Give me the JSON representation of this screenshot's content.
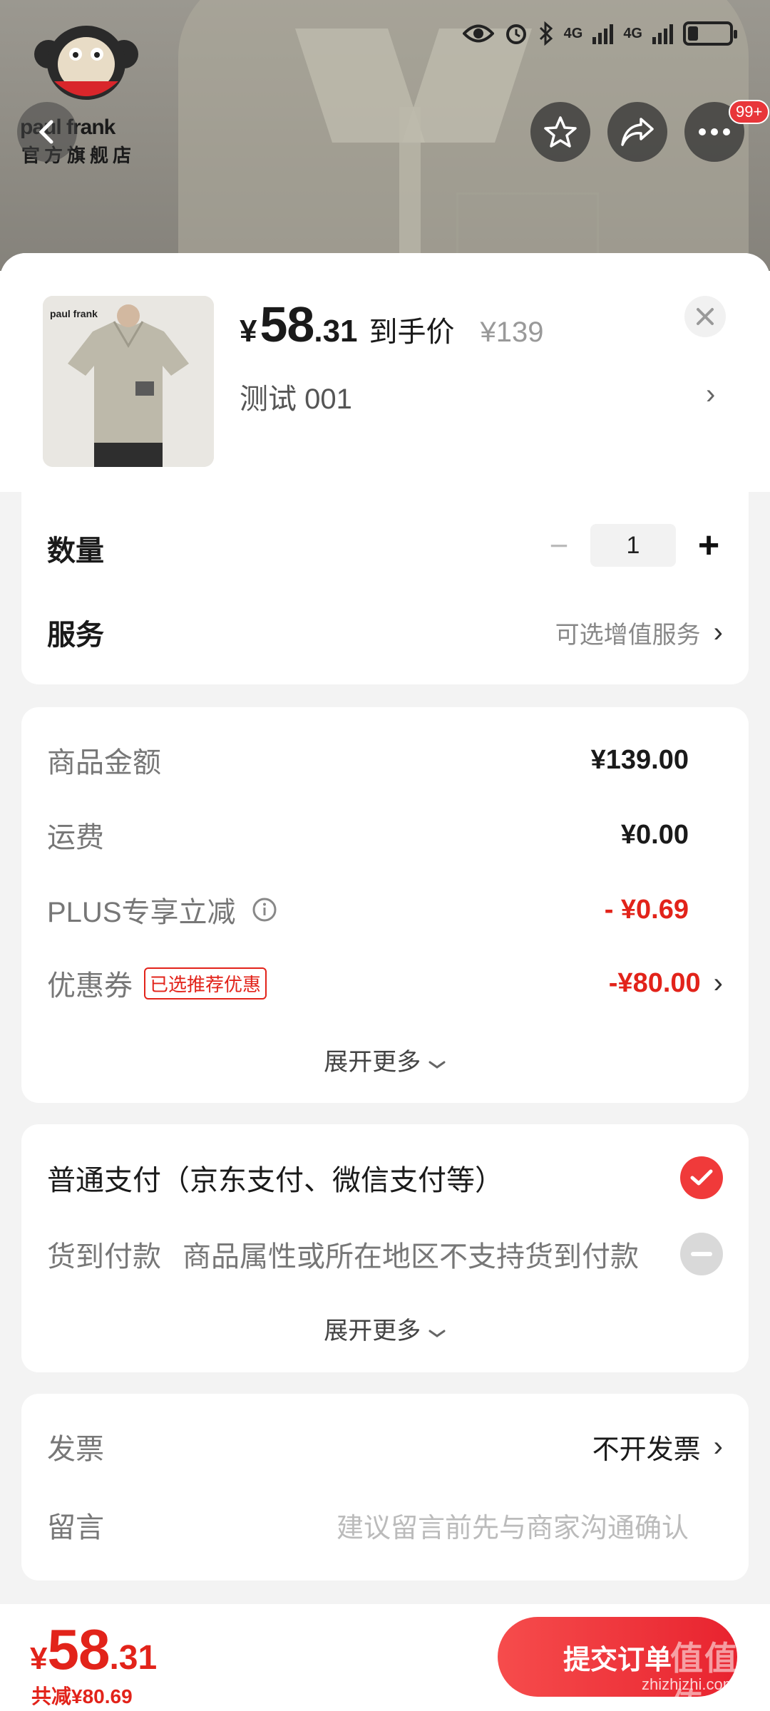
{
  "status_bar": {
    "network_1": "4G",
    "network_2": "4G"
  },
  "store": {
    "brand": "paul frank",
    "subtitle": "官方旗舰店"
  },
  "top_actions": {
    "badge": "99+"
  },
  "product": {
    "price_symbol": "¥",
    "price_int": "58",
    "price_dec": ".31",
    "price_label": "到手价",
    "original_price": "¥139",
    "variant": "测试  001"
  },
  "quantity": {
    "label": "数量",
    "value": "1"
  },
  "service": {
    "label": "服务",
    "value": "可选增值服务"
  },
  "summary": {
    "items": [
      {
        "label": "商品金额",
        "value": "¥139.00"
      },
      {
        "label": "运费",
        "value": "¥0.00"
      },
      {
        "label": "PLUS专享立减",
        "value": "- ¥0.69"
      },
      {
        "label": "优惠券",
        "tag": "已选推荐优惠",
        "value": "-¥80.00"
      }
    ],
    "expand": "展开更多"
  },
  "payment": {
    "options": [
      {
        "label": "普通支付（京东支付、微信支付等）"
      },
      {
        "label": "货到付款",
        "note": "商品属性或所在地区不支持货到付款"
      }
    ],
    "expand": "展开更多"
  },
  "invoice": {
    "label": "发票",
    "value": "不开发票"
  },
  "message": {
    "label": "留言",
    "placeholder": "建议留言前先与商家沟通确认"
  },
  "footer": {
    "total_symbol": "¥",
    "total_int": "58",
    "total_dec": ".31",
    "saved": "共减¥80.69",
    "submit": "提交订单"
  },
  "watermark": {
    "text": "zhizhizhi.com",
    "logo": "值值值"
  },
  "colors": {
    "accent": "#e2231a",
    "submit": "#ee2e36"
  }
}
